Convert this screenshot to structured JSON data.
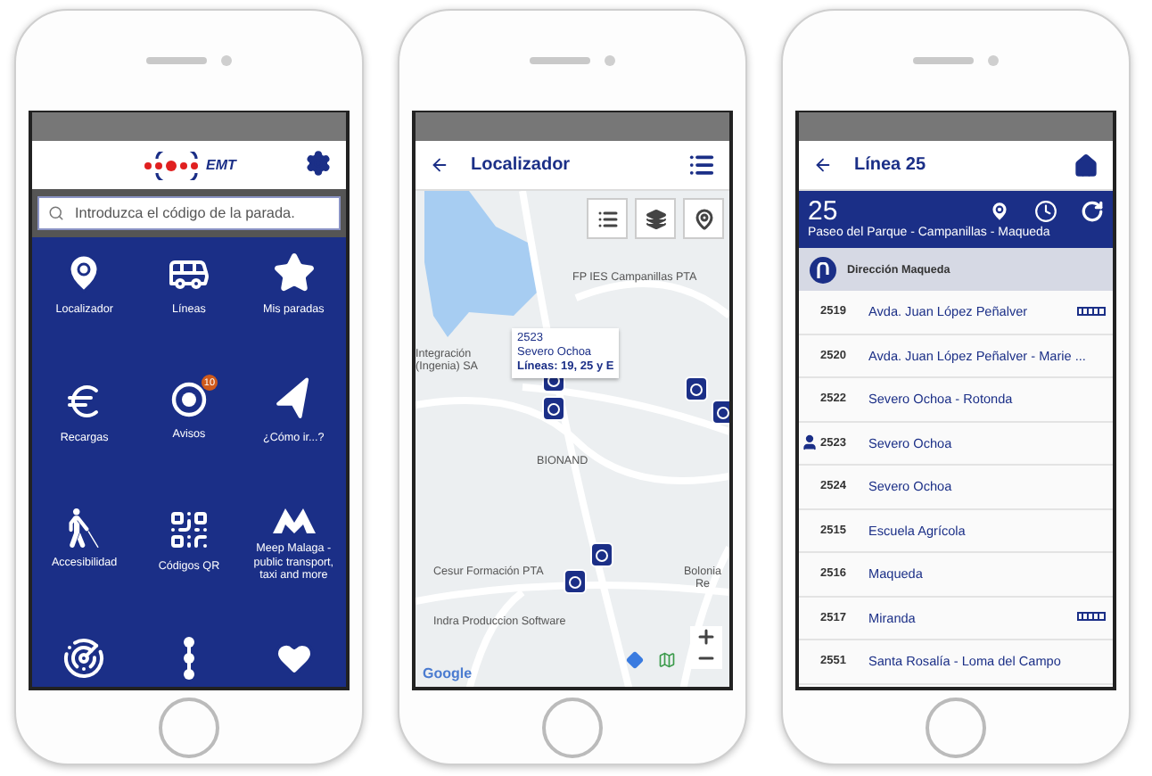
{
  "phones": [
    {
      "kind": "home",
      "logo": "EMT",
      "search": {
        "placeholder": "Introduzca el código de la parada."
      },
      "tiles": [
        {
          "label": "Localizador"
        },
        {
          "label": "Líneas"
        },
        {
          "label": "Mis paradas"
        },
        {
          "label": "Recargas"
        },
        {
          "label": "Avisos",
          "badge": "10"
        },
        {
          "label": "¿Cómo ir...?"
        },
        {
          "label": "Accesibilidad"
        },
        {
          "label": "Códigos QR"
        },
        {
          "label": "Meep Malaga - public transport, taxi and more"
        }
      ]
    },
    {
      "kind": "map",
      "title": "Localizador",
      "popup": {
        "code": "2523",
        "name": "Severo Ochoa",
        "lines": "Líneas: 19, 25 y E"
      },
      "places": [
        "FP IES Campanillas PTA",
        "Integración (Ingenia) SA",
        "BIONAND",
        "Cesur Formación PTA",
        "Bolonia Re",
        "Indra Produccion Software"
      ],
      "attribution": "Google"
    },
    {
      "kind": "line",
      "title": "Línea 25",
      "number": "25",
      "route": "Paseo del Parque - Campanillas - Maqueda",
      "direction": "Dirección Maqueda",
      "stops": [
        {
          "code": "2519",
          "name": "Avda. Juan López Peñalver",
          "current": false,
          "bus": true
        },
        {
          "code": "2520",
          "name": "Avda. Juan López Peñalver - Marie ...",
          "current": false,
          "bus": false
        },
        {
          "code": "2522",
          "name": "Severo Ochoa - Rotonda",
          "current": false,
          "bus": false
        },
        {
          "code": "2523",
          "name": "Severo Ochoa",
          "current": true,
          "bus": false
        },
        {
          "code": "2524",
          "name": "Severo Ochoa",
          "current": false,
          "bus": false
        },
        {
          "code": "2515",
          "name": "Escuela Agrícola",
          "current": false,
          "bus": false
        },
        {
          "code": "2516",
          "name": "Maqueda",
          "current": false,
          "bus": false
        },
        {
          "code": "2517",
          "name": "Miranda",
          "current": false,
          "bus": true
        },
        {
          "code": "2551",
          "name": "Santa Rosalía - Loma del Campo",
          "current": false,
          "bus": false
        }
      ]
    }
  ]
}
